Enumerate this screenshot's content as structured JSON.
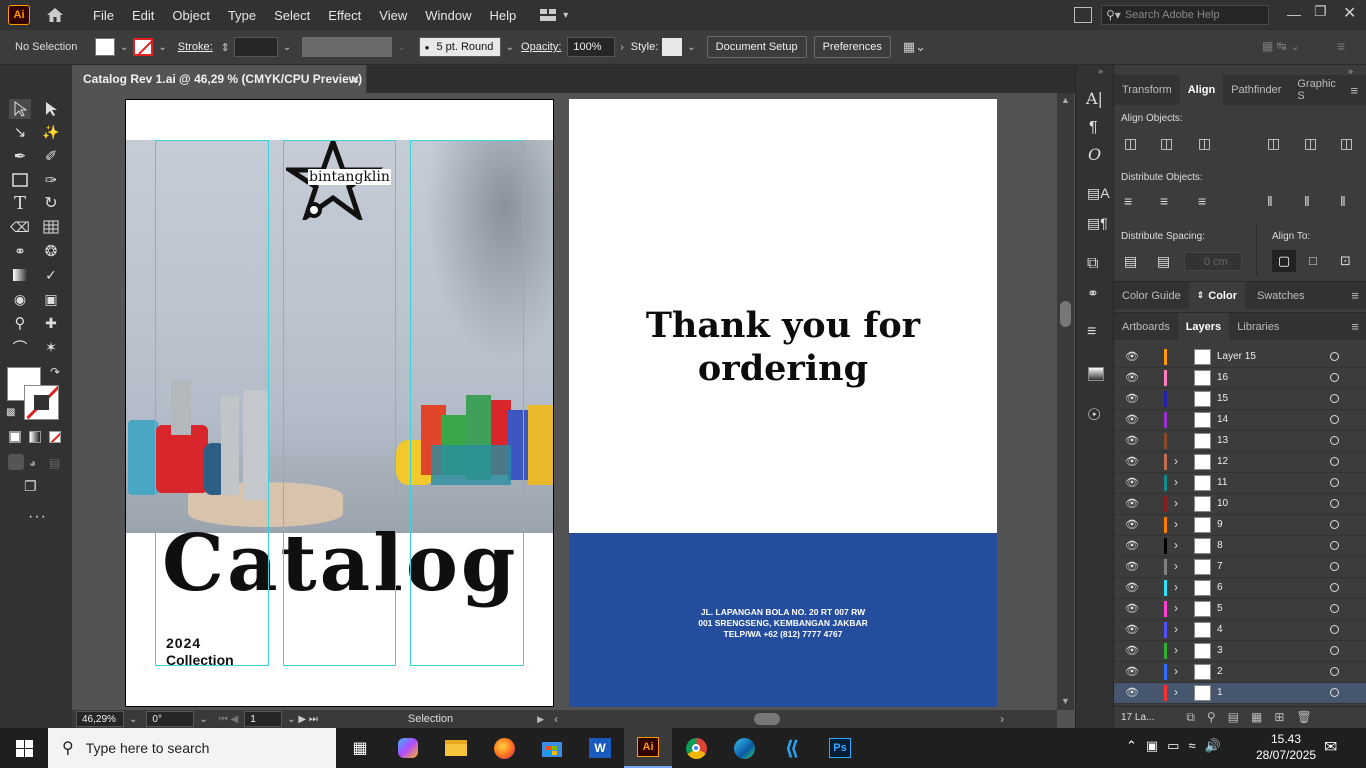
{
  "app": {
    "logo": "Ai"
  },
  "menu": [
    "File",
    "Edit",
    "Object",
    "Type",
    "Select",
    "Effect",
    "View",
    "Window",
    "Help"
  ],
  "search": {
    "placeholder": "Search Adobe Help"
  },
  "control": {
    "selection": "No Selection",
    "stroke_label": "Stroke:",
    "brush": "5 pt. Round",
    "opacity_label": "Opacity:",
    "opacity": "100%",
    "style_label": "Style:",
    "doc_setup": "Document Setup",
    "preferences": "Preferences"
  },
  "doc_tab": {
    "title": "Catalog Rev 1.ai @ 46,29 % (CMYK/CPU Preview)",
    "close": "×"
  },
  "artboard1": {
    "brand": "bintangklin",
    "headline": "Catalog",
    "year": "2024",
    "collection": "Collection"
  },
  "artboard2": {
    "thanks_line1": "Thank you for",
    "thanks_line2": "ordering",
    "address_line1": "JL. LAPANGAN BOLA NO. 20 RT 007 RW",
    "address_line2": "001 SRENGSENG, KEMBANGAN JAKBAR",
    "address_line3": "TELP/WA +62 (812) 7777 4767"
  },
  "status": {
    "zoom": "46,29%",
    "rotation": "0°",
    "artboard": "1",
    "tool": "Selection"
  },
  "panels": {
    "top_tabs": [
      "Transform",
      "Align",
      "Pathfinder",
      "Graphic S"
    ],
    "align_objects": "Align Objects:",
    "distribute_objects": "Distribute Objects:",
    "distribute_spacing": "Distribute Spacing:",
    "align_to": "Align To:",
    "spacing_value": "0 cm",
    "color_tabs": [
      "Color Guide",
      "Color",
      "Swatches"
    ],
    "layer_tabs": [
      "Artboards",
      "Layers",
      "Libraries"
    ],
    "layer_count": "17 La..."
  },
  "layers": [
    {
      "name": "Layer 15",
      "color": "#ff9a00",
      "expandable": false
    },
    {
      "name": "16",
      "color": "#ff7fbf",
      "expandable": false
    },
    {
      "name": "15",
      "color": "#2020b0",
      "expandable": false
    },
    {
      "name": "14",
      "color": "#9a2fd0",
      "expandable": false
    },
    {
      "name": "13",
      "color": "#8a4a2a",
      "expandable": false
    },
    {
      "name": "12",
      "color": "#c07050",
      "expandable": true
    },
    {
      "name": "11",
      "color": "#108a8a",
      "expandable": true
    },
    {
      "name": "10",
      "color": "#8a1e1e",
      "expandable": true
    },
    {
      "name": "9",
      "color": "#ff7a00",
      "expandable": true
    },
    {
      "name": "8",
      "color": "#000000",
      "expandable": true
    },
    {
      "name": "7",
      "color": "#808080",
      "expandable": true
    },
    {
      "name": "6",
      "color": "#30e0ff",
      "expandable": true
    },
    {
      "name": "5",
      "color": "#ff40d0",
      "expandable": true
    },
    {
      "name": "4",
      "color": "#5050ff",
      "expandable": true
    },
    {
      "name": "3",
      "color": "#30b030",
      "expandable": true
    },
    {
      "name": "2",
      "color": "#2f6bff",
      "expandable": true
    },
    {
      "name": "1",
      "color": "#ff3030",
      "expandable": true
    }
  ],
  "taskbar": {
    "search_placeholder": "Type here to search",
    "time": "15.43",
    "date": "28/07/2025"
  },
  "colors": {
    "blue_band": "#244d9e",
    "guide": "#39d3dc"
  }
}
